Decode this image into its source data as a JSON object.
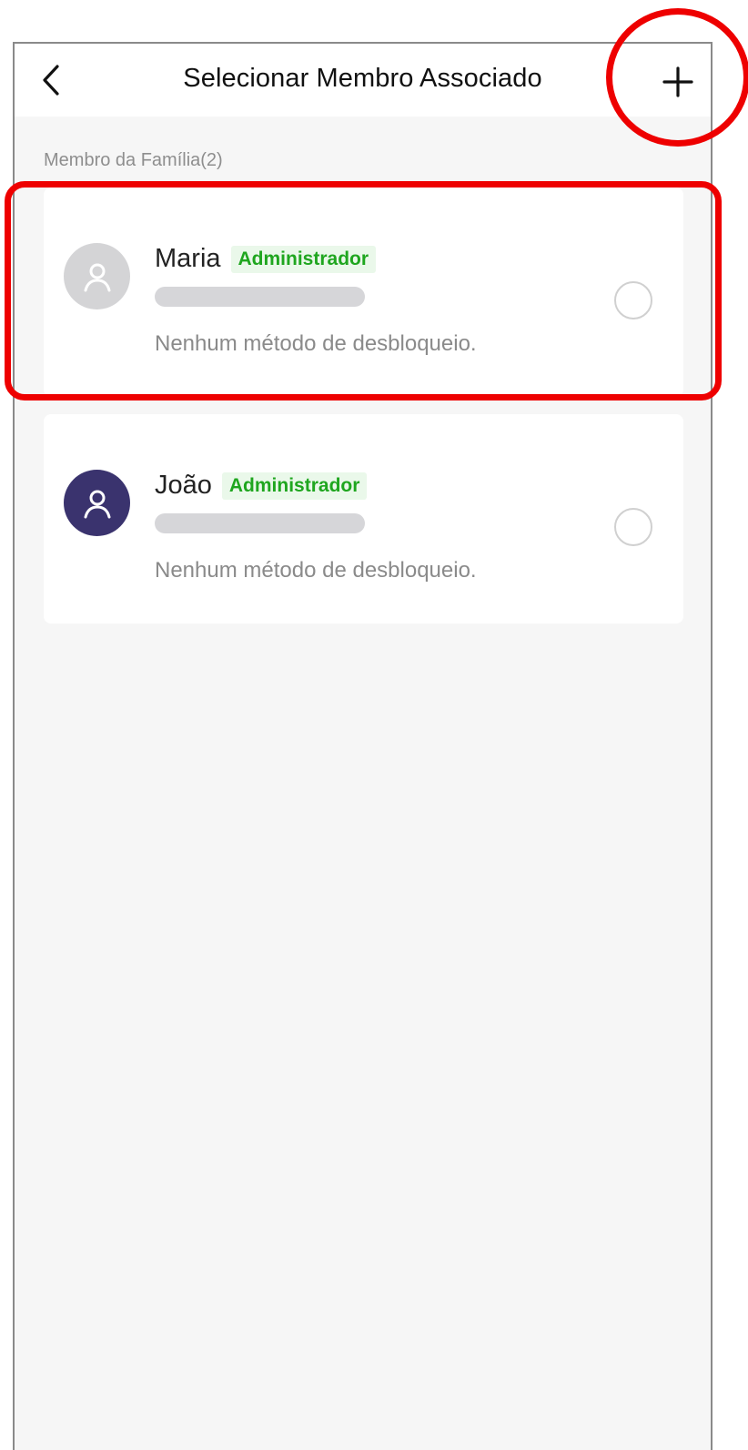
{
  "header": {
    "title": "Selecionar Membro Associado",
    "back_icon": "chevron-left-icon",
    "add_icon": "plus-icon"
  },
  "section": {
    "label": "Membro da Família(2)"
  },
  "members": [
    {
      "name": "Maria",
      "role": "Administrador",
      "status": "Nenhum método de desbloqueio.",
      "avatar_color": "#d4d4d6",
      "selected": false
    },
    {
      "name": "João",
      "role": "Administrador",
      "status": "Nenhum método de desbloqueio.",
      "avatar_color": "#3a336e",
      "selected": false
    }
  ],
  "colors": {
    "badge_text": "#1fa61f",
    "badge_bg": "#eaf8ea",
    "annotation": "#ee0000",
    "background": "#f6f6f6"
  }
}
